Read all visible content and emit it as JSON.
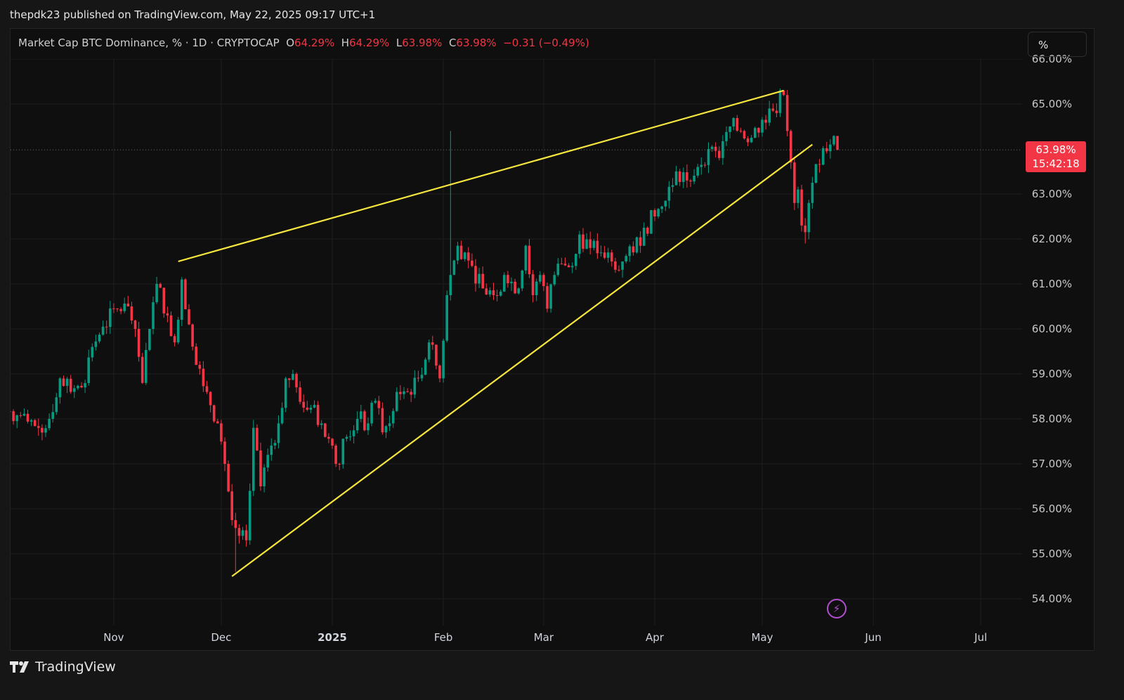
{
  "header": {
    "published": "thepdk23 published on TradingView.com, May 22, 2025 09:17 UTC+1"
  },
  "legend": {
    "symbol": "Market Cap BTC Dominance, % · 1D · CRYPTOCAP",
    "o_label": "O",
    "o": "64.29%",
    "h_label": "H",
    "h": "64.29%",
    "l_label": "L",
    "l": "63.98%",
    "c_label": "C",
    "c": "63.98%",
    "change": "−0.31 (−0.49%)"
  },
  "scale_button": "%",
  "last_price_tag": {
    "price": "63.98%",
    "countdown": "15:42:18"
  },
  "footer": {
    "brand": "TradingView"
  },
  "colors": {
    "up": "#089981",
    "down": "#f23645",
    "trendline": "#f5e63d",
    "background": "#0f0f0f"
  },
  "icons": [
    "tradingview-logo-icon",
    "lightning-icon"
  ],
  "chart_data": {
    "type": "candlestick",
    "title": "Market Cap BTC Dominance, % · 1D · CRYPTOCAP",
    "ylabel": "%",
    "ylim": [
      53.6,
      66.0
    ],
    "xrange": [
      "2024-10-03",
      "2025-07-15"
    ],
    "y_ticks": [
      "66.00%",
      "65.00%",
      "63.00%",
      "62.00%",
      "61.00%",
      "60.00%",
      "59.00%",
      "58.00%",
      "57.00%",
      "56.00%",
      "55.00%",
      "54.00%"
    ],
    "y_tick_values": [
      66,
      65,
      63,
      62,
      61,
      60,
      59,
      58,
      57,
      56,
      55,
      54
    ],
    "x_ticks": [
      {
        "label": "Nov",
        "date": "2024-11-01"
      },
      {
        "label": "Dec",
        "date": "2024-12-01"
      },
      {
        "label": "2025",
        "date": "2025-01-01",
        "bold": true
      },
      {
        "label": "Feb",
        "date": "2025-02-01"
      },
      {
        "label": "Mar",
        "date": "2025-03-01"
      },
      {
        "label": "Apr",
        "date": "2025-04-01"
      },
      {
        "label": "May",
        "date": "2025-05-01"
      },
      {
        "label": "Jun",
        "date": "2025-06-01"
      },
      {
        "label": "Jul",
        "date": "2025-07-01"
      }
    ],
    "approx_closes": [
      [
        "2024-10-03",
        58.17
      ],
      [
        "2024-10-08",
        57.94
      ],
      [
        "2024-10-11",
        57.8
      ],
      [
        "2024-10-14",
        58.0
      ],
      [
        "2024-10-17",
        58.9
      ],
      [
        "2024-10-20",
        58.6
      ],
      [
        "2024-10-23",
        58.7
      ],
      [
        "2024-10-26",
        59.6
      ],
      [
        "2024-10-29",
        60.05
      ],
      [
        "2024-11-02",
        60.44
      ],
      [
        "2024-11-05",
        60.5
      ],
      [
        "2024-11-07",
        60.0
      ],
      [
        "2024-11-09",
        58.8
      ],
      [
        "2024-11-11",
        60.0
      ],
      [
        "2024-11-13",
        61.0
      ],
      [
        "2024-11-16",
        60.3
      ],
      [
        "2024-11-18",
        59.7
      ],
      [
        "2024-11-20",
        61.1
      ],
      [
        "2024-11-22",
        60.1
      ],
      [
        "2024-11-24",
        59.2
      ],
      [
        "2024-11-27",
        58.6
      ],
      [
        "2024-11-30",
        57.9
      ],
      [
        "2024-12-02",
        57.0
      ],
      [
        "2024-12-04",
        55.75
      ],
      [
        "2024-12-06",
        55.4
      ],
      [
        "2024-12-08",
        55.3
      ],
      [
        "2024-12-09",
        56.4
      ],
      [
        "2024-12-10",
        57.8
      ],
      [
        "2024-12-12",
        56.5
      ],
      [
        "2024-12-14",
        57.2
      ],
      [
        "2024-12-17",
        57.9
      ],
      [
        "2024-12-19",
        58.9
      ],
      [
        "2024-12-21",
        59.0
      ],
      [
        "2024-12-24",
        58.25
      ],
      [
        "2024-12-26",
        58.25
      ],
      [
        "2024-12-29",
        57.9
      ],
      [
        "2025-01-02",
        57.0
      ],
      [
        "2025-01-05",
        57.6
      ],
      [
        "2025-01-08",
        58.0
      ],
      [
        "2025-01-11",
        57.9
      ],
      [
        "2025-01-13",
        58.4
      ],
      [
        "2025-01-15",
        57.7
      ],
      [
        "2025-01-17",
        57.9
      ],
      [
        "2025-01-19",
        58.6
      ],
      [
        "2025-01-22",
        58.6
      ],
      [
        "2025-01-25",
        58.9
      ],
      [
        "2025-01-28",
        59.7
      ],
      [
        "2025-01-31",
        58.9
      ],
      [
        "2025-02-02",
        60.75
      ],
      [
        "2025-02-03",
        61.2
      ],
      [
        "2025-02-05",
        61.85
      ],
      [
        "2025-02-07",
        61.7
      ],
      [
        "2025-02-09",
        61.4
      ],
      [
        "2025-02-12",
        60.9
      ],
      [
        "2025-02-15",
        60.75
      ],
      [
        "2025-02-18",
        61.2
      ],
      [
        "2025-02-20",
        61.05
      ],
      [
        "2025-02-22",
        60.9
      ],
      [
        "2025-02-24",
        61.85
      ],
      [
        "2025-02-26",
        60.75
      ],
      [
        "2025-02-28",
        61.2
      ],
      [
        "2025-03-02",
        60.45
      ],
      [
        "2025-03-04",
        61.2
      ],
      [
        "2025-03-06",
        61.45
      ],
      [
        "2025-03-09",
        61.4
      ],
      [
        "2025-03-11",
        62.1
      ],
      [
        "2025-03-14",
        61.8
      ],
      [
        "2025-03-17",
        61.7
      ],
      [
        "2025-03-20",
        61.5
      ],
      [
        "2025-03-23",
        61.5
      ],
      [
        "2025-03-26",
        61.7
      ],
      [
        "2025-03-29",
        62.25
      ],
      [
        "2025-04-01",
        62.5
      ],
      [
        "2025-04-04",
        62.85
      ],
      [
        "2025-04-07",
        63.5
      ],
      [
        "2025-04-10",
        63.3
      ],
      [
        "2025-04-13",
        63.6
      ],
      [
        "2025-04-16",
        64.0
      ],
      [
        "2025-04-19",
        63.8
      ],
      [
        "2025-04-22",
        64.5
      ],
      [
        "2025-04-25",
        64.4
      ],
      [
        "2025-04-28",
        64.25
      ],
      [
        "2025-05-01",
        64.65
      ],
      [
        "2025-05-03",
        64.9
      ],
      [
        "2025-05-05",
        64.8
      ],
      [
        "2025-05-06",
        65.3
      ],
      [
        "2025-05-07",
        65.2
      ],
      [
        "2025-05-08",
        64.4
      ],
      [
        "2025-05-09",
        63.7
      ],
      [
        "2025-05-10",
        62.8
      ],
      [
        "2025-05-11",
        63.1
      ],
      [
        "2025-05-12",
        62.3
      ],
      [
        "2025-05-13",
        62.15
      ],
      [
        "2025-05-14",
        62.8
      ],
      [
        "2025-05-15",
        63.25
      ],
      [
        "2025-05-17",
        63.65
      ],
      [
        "2025-05-19",
        63.95
      ],
      [
        "2025-05-20",
        64.1
      ],
      [
        "2025-05-21",
        64.29
      ],
      [
        "2025-05-22",
        63.98
      ]
    ],
    "notable_wicks": [
      [
        "2025-02-03",
        64.4,
        "high"
      ],
      [
        "2024-12-05",
        54.6,
        "low"
      ],
      [
        "2025-05-13",
        61.9,
        "low"
      ]
    ],
    "last_candle": {
      "date": "2025-05-22",
      "open": 64.29,
      "high": 64.29,
      "low": 63.98,
      "close": 63.98
    },
    "last_price_line": 63.98,
    "trendlines": [
      {
        "name": "upper-wedge-line",
        "from": [
          "2024-11-19",
          61.5
        ],
        "to": [
          "2025-05-07",
          65.3
        ]
      },
      {
        "name": "lower-wedge-line",
        "from": [
          "2024-12-04",
          54.5
        ],
        "to": [
          "2025-05-15",
          64.1
        ]
      }
    ]
  }
}
